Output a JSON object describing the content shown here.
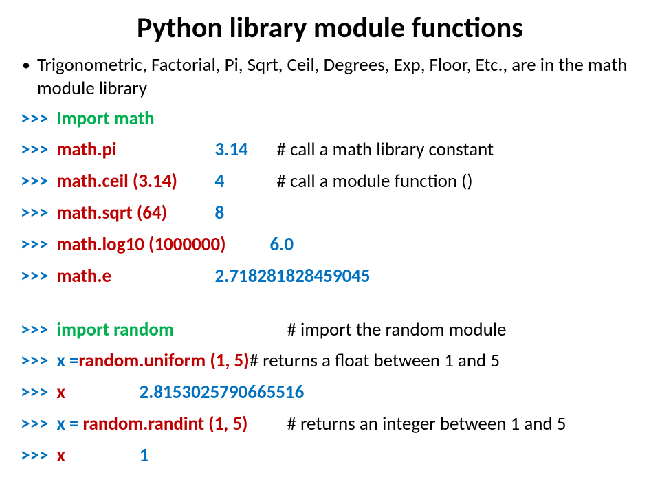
{
  "title": "Python library module functions",
  "bullet_text": "Trigonometric, Factorial, Pi, Sqrt, Ceil, Degrees, Exp, Floor, Etc., are in the math module library",
  "prompt": ">>> ",
  "lines": {
    "import_math": "Import math",
    "math_pi_cmd": "math.pi",
    "math_pi_val": "3.14",
    "math_pi_comment": "# call a math library constant",
    "math_ceil_cmd": "math.ceil (3.14)",
    "math_ceil_val": "4",
    "math_ceil_comment": "# call a module function ()",
    "math_sqrt_cmd": "math.sqrt (64)",
    "math_sqrt_val": "8",
    "math_log10_cmd": "math.log10 (1000000)",
    "math_log10_val": "6.0",
    "math_e_cmd": "math.e",
    "math_e_val": "2.718281828459045",
    "import_random": "import random",
    "import_random_comment": "# import the random module",
    "uniform_x": "x = ",
    "uniform_cmd": "random.uniform (1, 5)",
    "uniform_comment": " # returns a float between 1 and 5",
    "x1_cmd": "x",
    "x1_val": "2.8153025790665516",
    "randint_x": "x = ",
    "randint_cmd": "random.randint (1, 5)",
    "randint_comment": "# returns an integer between 1 and 5",
    "x2_cmd": "x",
    "x2_val": "1"
  }
}
